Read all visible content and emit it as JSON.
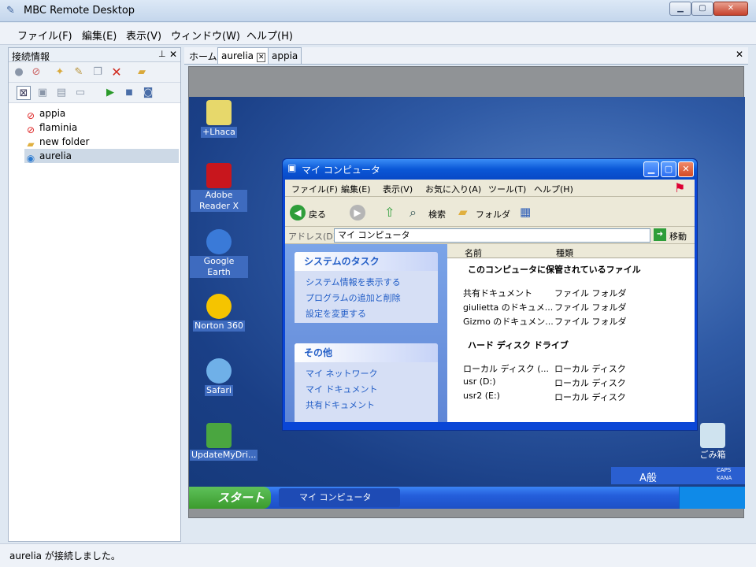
{
  "app": {
    "title": "MBC Remote Desktop",
    "status": "aurelia が接続しました。"
  },
  "menu": [
    "ファイル(F)",
    "編集(E)",
    "表示(V)",
    "ウィンドウ(W)",
    "ヘルプ(H)"
  ],
  "panel": {
    "title": "接続情報",
    "pin": "ᵖ",
    "close": "✕"
  },
  "tree": [
    {
      "label": "appia",
      "icon": "blocked-icon"
    },
    {
      "label": "flaminia",
      "icon": "blocked-icon"
    },
    {
      "label": "new folder",
      "icon": "folder-icon"
    },
    {
      "label": "aurelia",
      "icon": "globe-icon"
    }
  ],
  "tabs": {
    "home": "ホーム",
    "t1": "aurelia",
    "t2": "appia",
    "close": "✕"
  },
  "desktop": [
    {
      "label": "+Lhaca"
    },
    {
      "label": "Adobe Reader X"
    },
    {
      "label": "Google Earth"
    },
    {
      "label": "Norton 360"
    },
    {
      "label": "Safari"
    },
    {
      "label": "UpdateMyDri..."
    }
  ],
  "recycle": "ごみ箱",
  "xp": {
    "title": "マイ コンピュータ",
    "menu": [
      "ファイル(F)",
      "編集(E)",
      "表示(V)",
      "お気に入り(A)",
      "ツール(T)",
      "ヘルプ(H)"
    ],
    "back": "戻る",
    "search": "検索",
    "folder": "フォルダ",
    "addr_label": "アドレス(D)",
    "addr_value": "マイ コンピュータ",
    "go": "移動",
    "task1": {
      "title": "システムのタスク",
      "links": [
        "システム情報を表示する",
        "プログラムの追加と削除",
        "設定を変更する"
      ]
    },
    "task2": {
      "title": "その他",
      "links": [
        "マイ ネットワーク",
        "マイ ドキュメント",
        "共有ドキュメント"
      ]
    },
    "headers": [
      "名前",
      "種類"
    ],
    "group1": "このコンピュータに保管されているファイル",
    "files": [
      [
        "共有ドキュメント",
        "ファイル フォルダ"
      ],
      [
        "giulietta のドキュメ...",
        "ファイル フォルダ"
      ],
      [
        "Gizmo のドキュメン...",
        "ファイル フォルダ"
      ]
    ],
    "group2": "ハード ディスク ドライブ",
    "drives": [
      [
        "ローカル ディスク (...",
        "ローカル ディスク"
      ],
      [
        "usr (D:)",
        "ローカル ディスク"
      ],
      [
        "usr2 (E:)",
        "ローカル ディスク"
      ]
    ]
  },
  "taskbar": {
    "start": "スタート",
    "task": "マイ コンピュータ",
    "ime": "A般",
    "caps": "CAPS",
    "kana": "KANA"
  }
}
